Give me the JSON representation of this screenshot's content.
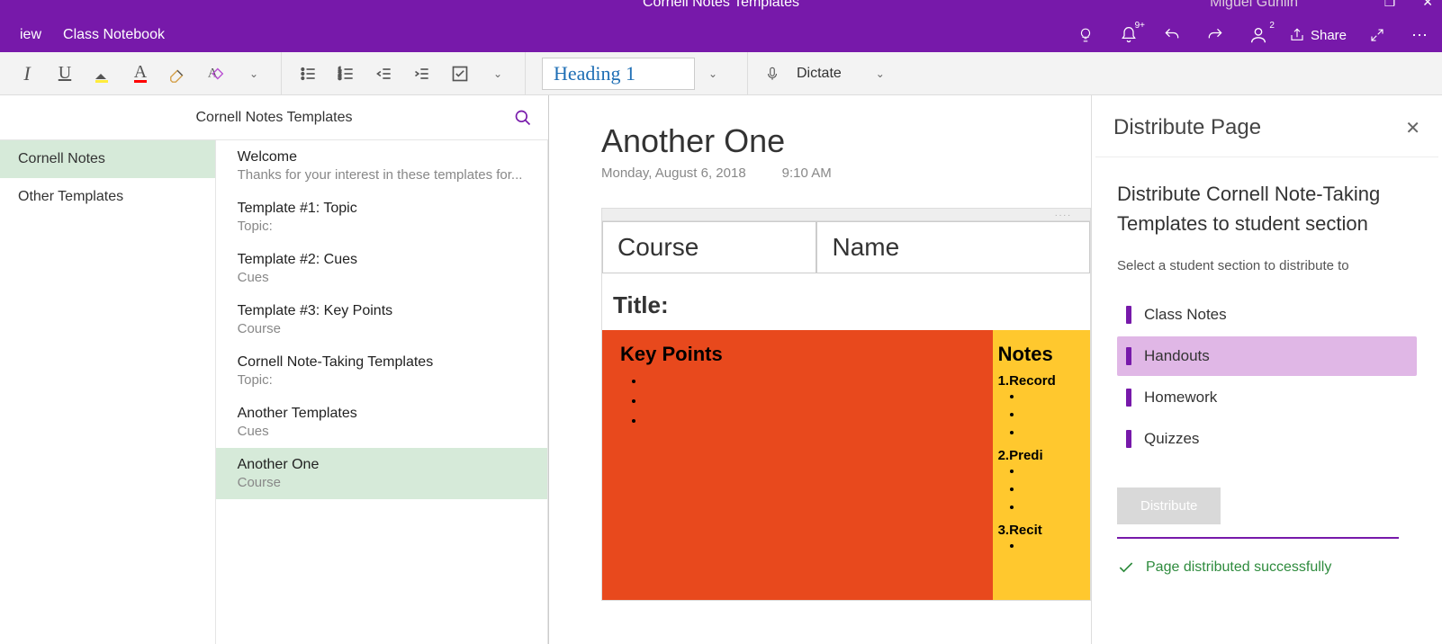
{
  "window": {
    "doc_title": "Cornell Notes Templates",
    "user_name": "Miguel Guhlin"
  },
  "tabs": {
    "view": "iew",
    "class_notebook": "Class Notebook"
  },
  "top_right": {
    "notif_badge": "9+",
    "account_badge": "2",
    "share": "Share"
  },
  "ribbon": {
    "style": "Heading 1",
    "dictate": "Dictate"
  },
  "nav": {
    "title": "Cornell Notes Templates",
    "sections": [
      {
        "label": "Cornell Notes",
        "active": true
      },
      {
        "label": "Other Templates",
        "active": false
      }
    ],
    "pages": [
      {
        "title": "Welcome",
        "subtitle": "Thanks for your interest in these templates for..."
      },
      {
        "title": "Template #1: Topic",
        "subtitle": "Topic:"
      },
      {
        "title": "Template #2: Cues",
        "subtitle": "Cues"
      },
      {
        "title": "Template #3: Key Points",
        "subtitle": "Course"
      },
      {
        "title": "Cornell Note-Taking Templates",
        "subtitle": "Topic:"
      },
      {
        "title": "Another Templates",
        "subtitle": "Cues"
      },
      {
        "title": "Another One",
        "subtitle": "Course",
        "active": true
      }
    ]
  },
  "page": {
    "title": "Another One",
    "date": "Monday, August 6, 2018",
    "time": "9:10 AM",
    "course_label": "Course",
    "name_label": "Name",
    "title_label": "Title:",
    "keypoints": "Key Points",
    "notes": "Notes",
    "steps": {
      "s1": "1.Record",
      "s2": "2.Predi",
      "s3": "3.Recit"
    }
  },
  "panel": {
    "heading": "Distribute Page",
    "subheading": "Distribute Cornell Note-Taking Templates to student section",
    "instruction": "Select a student section to distribute to",
    "options": [
      {
        "label": "Class Notes"
      },
      {
        "label": "Handouts",
        "selected": true
      },
      {
        "label": "Homework"
      },
      {
        "label": "Quizzes"
      }
    ],
    "button": "Distribute",
    "success": "Page distributed successfully"
  }
}
